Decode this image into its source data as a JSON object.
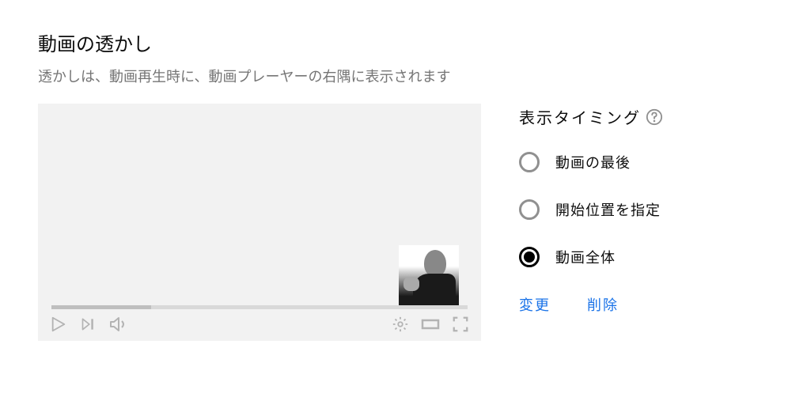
{
  "title": "動画の透かし",
  "subtitle": "透かしは、動画再生時に、動画プレーヤーの右隅に表示されます",
  "timing": {
    "header": "表示タイミング",
    "options": [
      {
        "label": "動画の最後"
      },
      {
        "label": "開始位置を指定"
      },
      {
        "label": "動画全体"
      }
    ],
    "selected": 2
  },
  "actions": {
    "change": "変更",
    "delete": "削除"
  }
}
